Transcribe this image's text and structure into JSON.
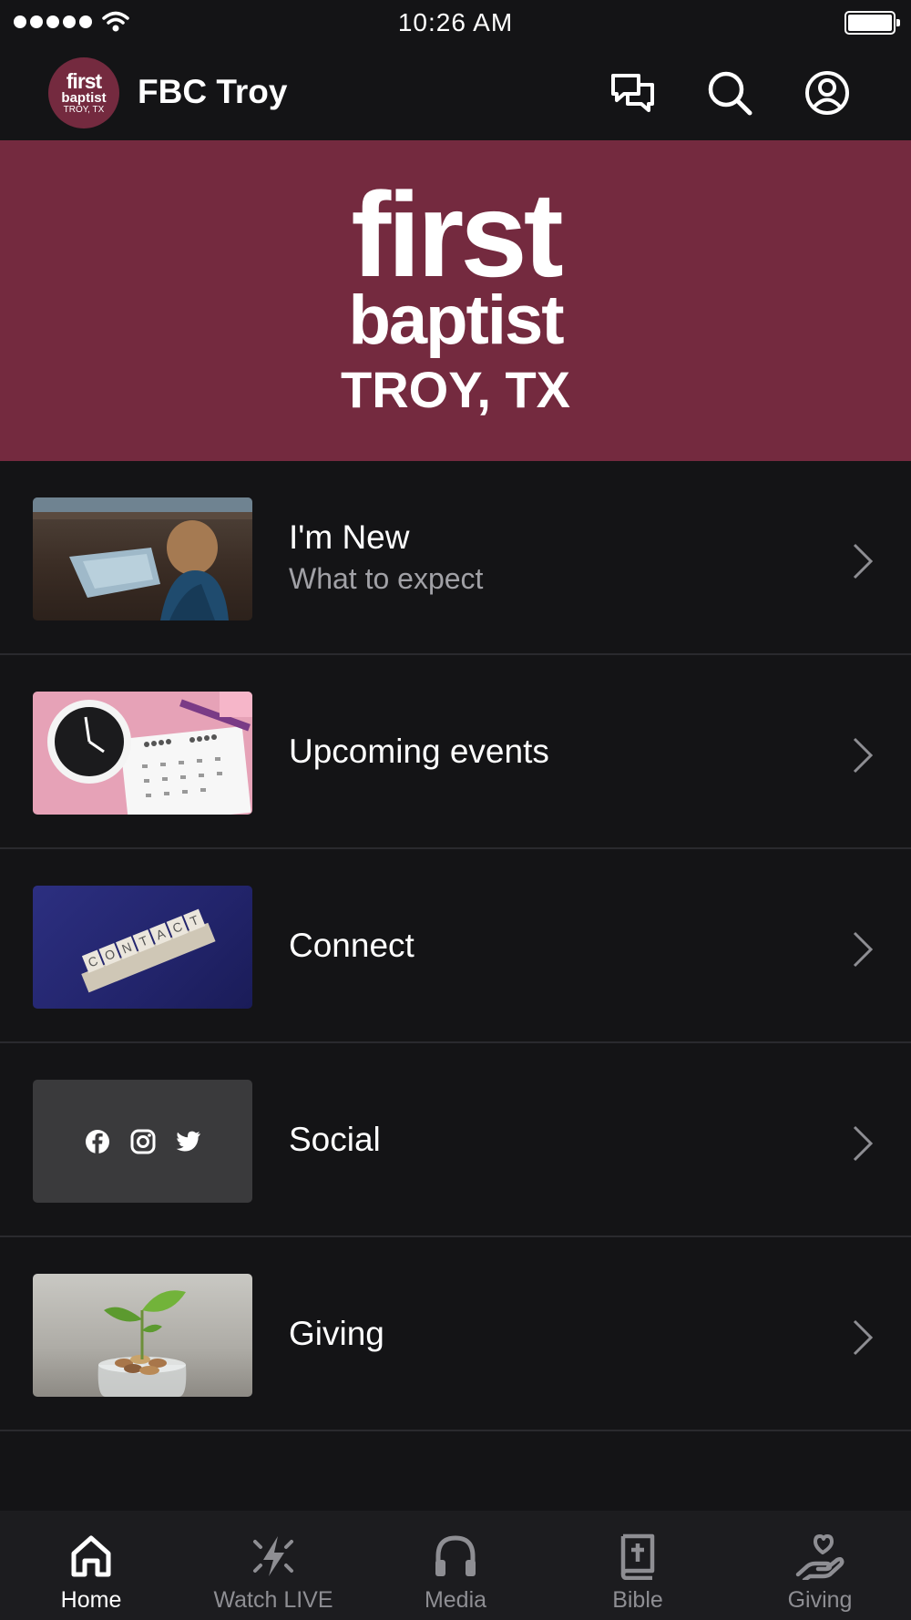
{
  "status_bar": {
    "time": "10:26 AM"
  },
  "header": {
    "logo_text": [
      "first",
      "baptist",
      "TROY, TX"
    ],
    "title": "FBC Troy",
    "icons": [
      "chat-icon",
      "search-icon",
      "profile-icon"
    ]
  },
  "banner": {
    "line1": "first",
    "line2": "baptist",
    "line3": "TROY, TX",
    "background": "#742a3f"
  },
  "list": {
    "items": [
      {
        "title": "I'm New",
        "subtitle": "What to expect",
        "thumbnail": "child-with-map"
      },
      {
        "title": "Upcoming events",
        "subtitle": "",
        "thumbnail": "clock-and-calendar"
      },
      {
        "title": "Connect",
        "subtitle": "",
        "thumbnail": "contact-tiles"
      },
      {
        "title": "Social",
        "subtitle": "",
        "thumbnail": "social-icons"
      },
      {
        "title": "Giving",
        "subtitle": "",
        "thumbnail": "plant-in-coins"
      }
    ]
  },
  "tabbar": {
    "tabs": [
      {
        "label": "Home",
        "icon": "home-icon",
        "active": true
      },
      {
        "label": "Watch LIVE",
        "icon": "lightning-icon",
        "active": false
      },
      {
        "label": "Media",
        "icon": "headphones-icon",
        "active": false
      },
      {
        "label": "Bible",
        "icon": "bible-icon",
        "active": false
      },
      {
        "label": "Giving",
        "icon": "giving-hand-icon",
        "active": false
      }
    ]
  },
  "colors": {
    "background": "#141416",
    "brand": "#742a3f",
    "divider": "#2a2a2e",
    "inactive_tab": "#8e8e93"
  }
}
